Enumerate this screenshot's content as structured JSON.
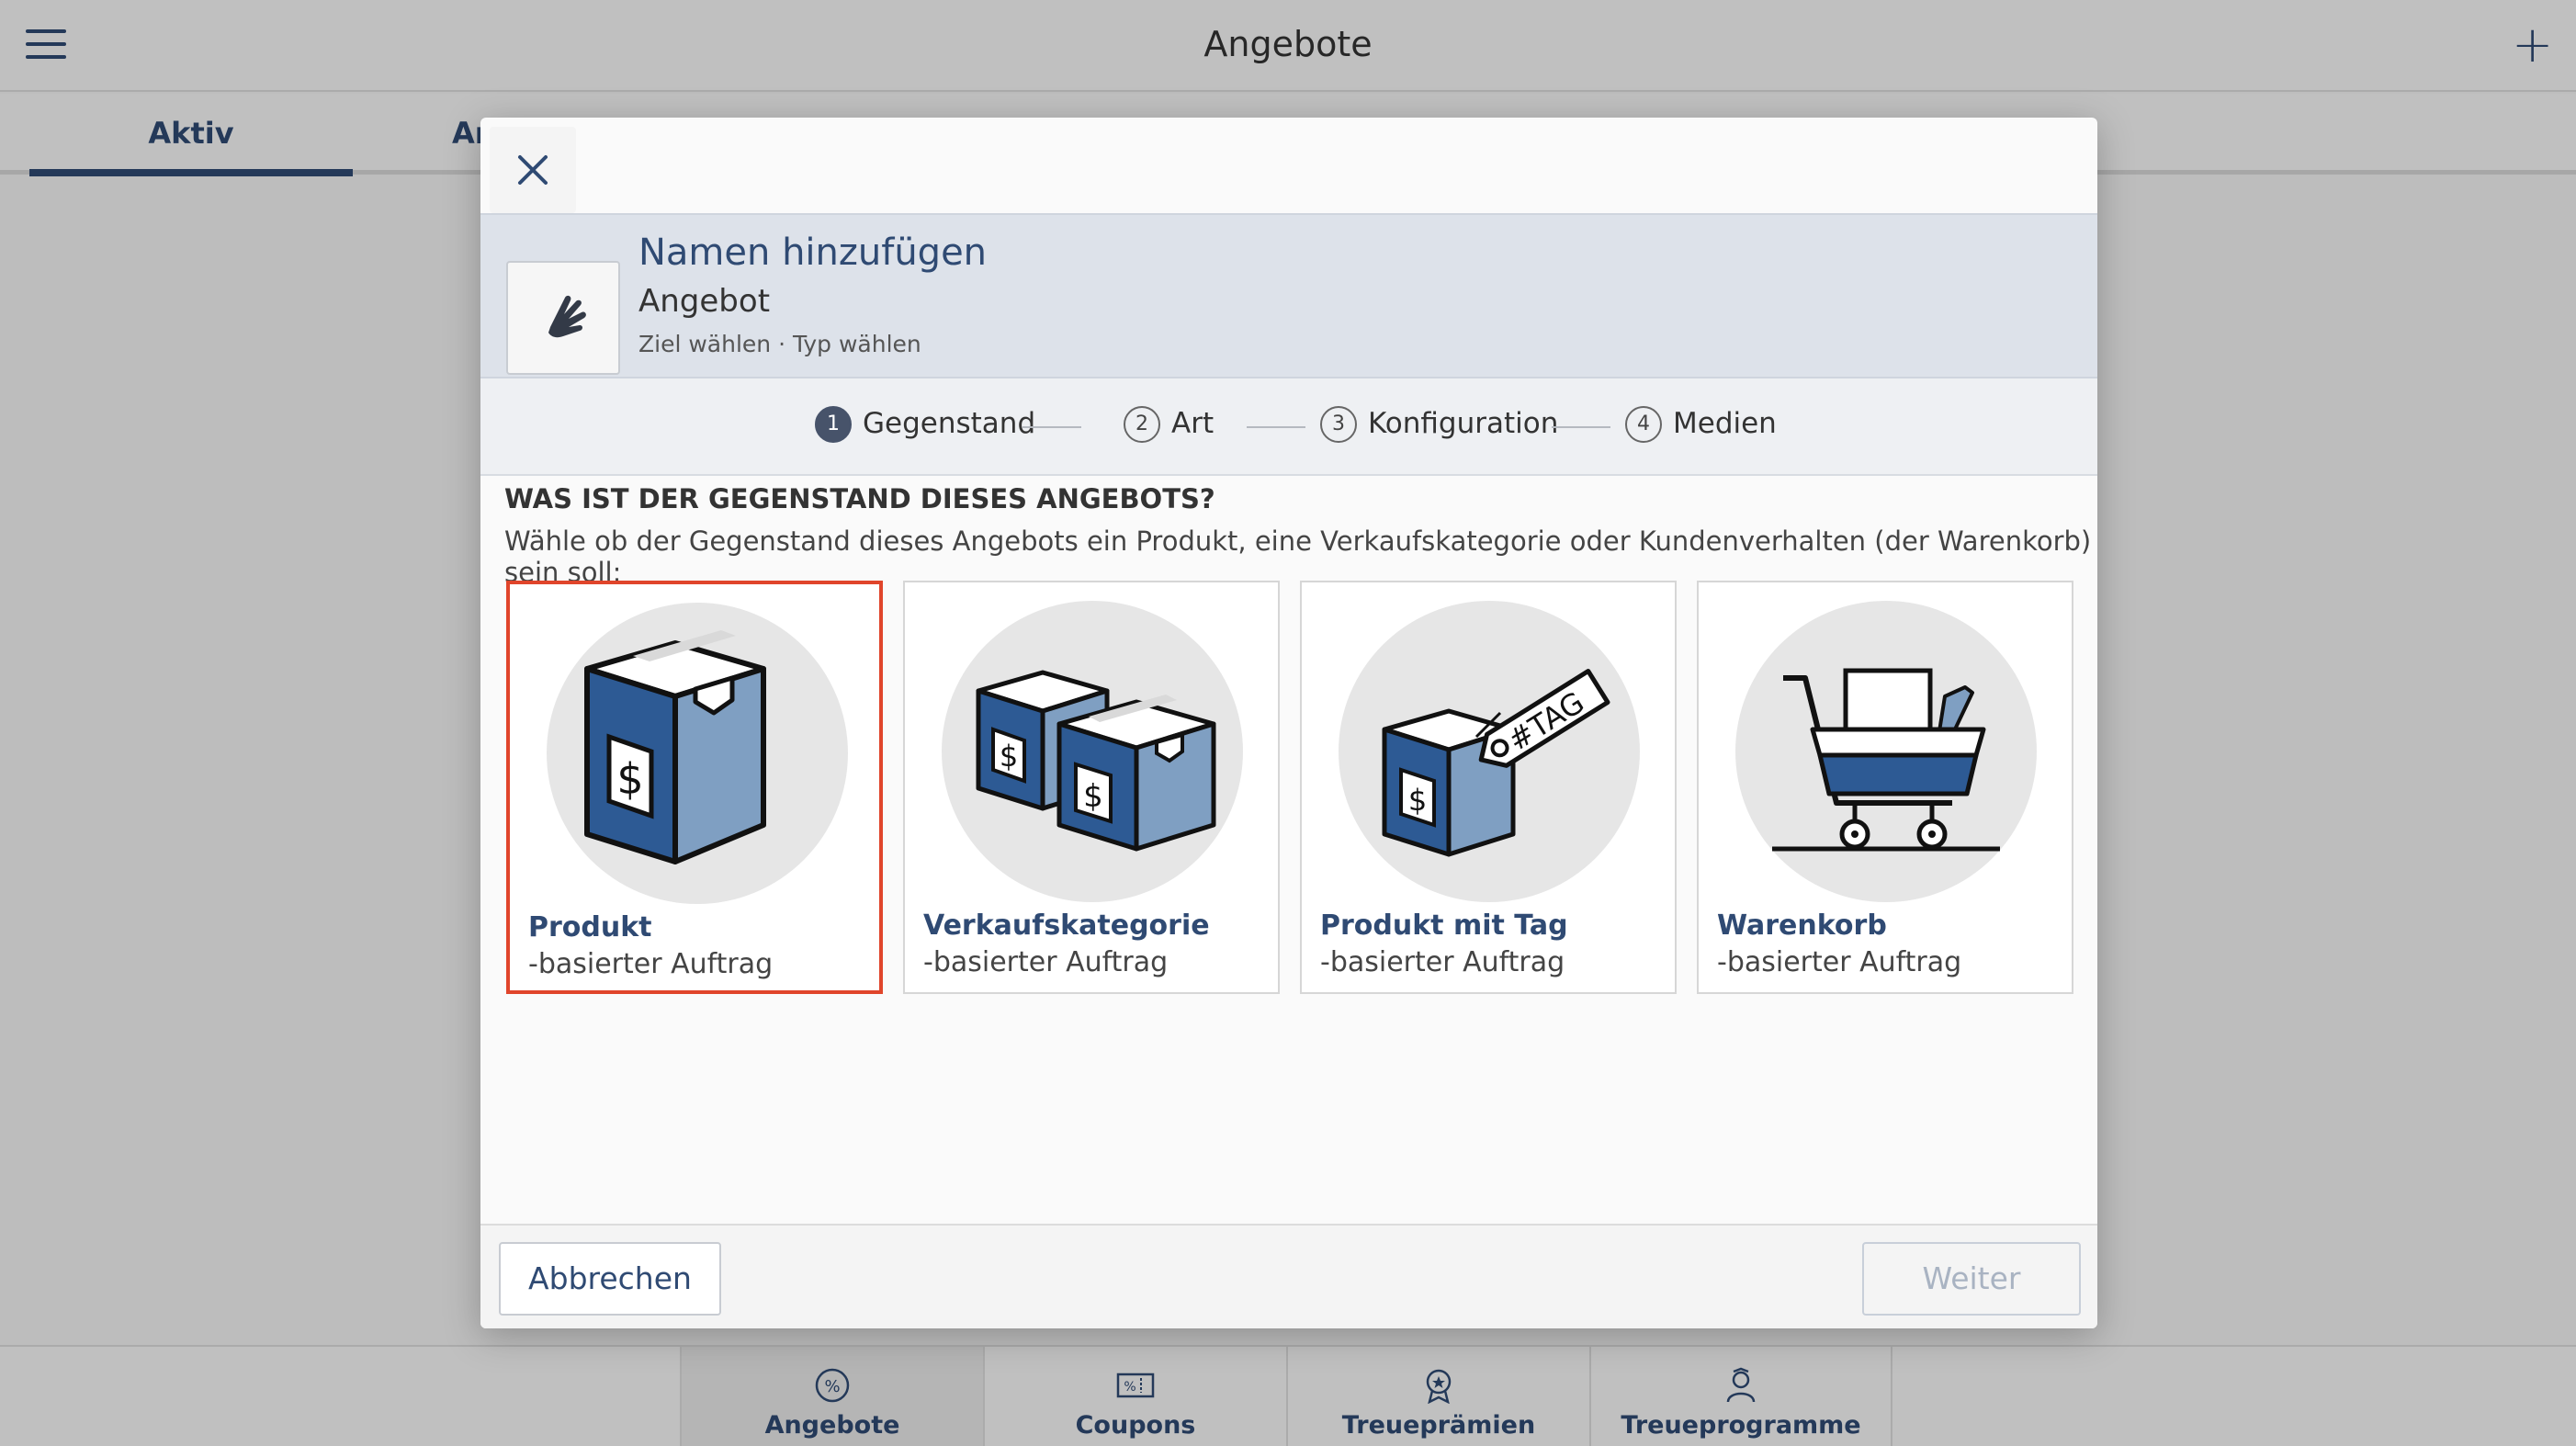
{
  "app": {
    "title": "Angebote",
    "tabs": [
      {
        "label": "Aktiv"
      },
      {
        "label": "Ar"
      }
    ]
  },
  "bottom_nav": [
    {
      "label": "Angebote",
      "icon": "percent-badge-icon"
    },
    {
      "label": "Coupons",
      "icon": "coupon-icon"
    },
    {
      "label": "Treueprämien",
      "icon": "award-icon"
    },
    {
      "label": "Treueprogramme",
      "icon": "person-badge-icon"
    }
  ],
  "modal": {
    "title": "Namen hinzufügen",
    "subtitle": "Angebot",
    "breadcrumb": "Ziel wählen · Typ wählen",
    "steps": [
      {
        "num": "1",
        "label": "Gegenstand",
        "active": true
      },
      {
        "num": "2",
        "label": "Art",
        "active": false
      },
      {
        "num": "3",
        "label": "Konfiguration",
        "active": false
      },
      {
        "num": "4",
        "label": "Medien",
        "active": false
      }
    ],
    "question": "WAS IST DER GEGENSTAND DIESES ANGEBOTS?",
    "description": "Wähle ob der Gegenstand dieses Angebots ein Produkt, eine Verkaufskategorie oder Kundenverhalten (der Warenkorb) sein soll:",
    "options": [
      {
        "name": "Produkt",
        "sub": "-basierter Auftrag",
        "selected": true,
        "icon": "box-icon"
      },
      {
        "name": "Verkaufskategorie",
        "sub": "-basierter Auftrag",
        "selected": false,
        "icon": "boxes-icon"
      },
      {
        "name": "Produkt mit Tag",
        "sub": "-basierter Auftrag",
        "selected": false,
        "icon": "tagged-box-icon",
        "tag_text": "#TAG"
      },
      {
        "name": "Warenkorb",
        "sub": "-basierter Auftrag",
        "selected": false,
        "icon": "cart-icon"
      }
    ],
    "buttons": {
      "cancel": "Abbrechen",
      "next": "Weiter"
    },
    "icons": {
      "close": "close-icon",
      "header": "hand-icon"
    }
  },
  "colors": {
    "accent": "#2f4a73",
    "box_dark": "#2d5a94",
    "box_light": "#7f9fc2",
    "selection": "#e0452b"
  }
}
